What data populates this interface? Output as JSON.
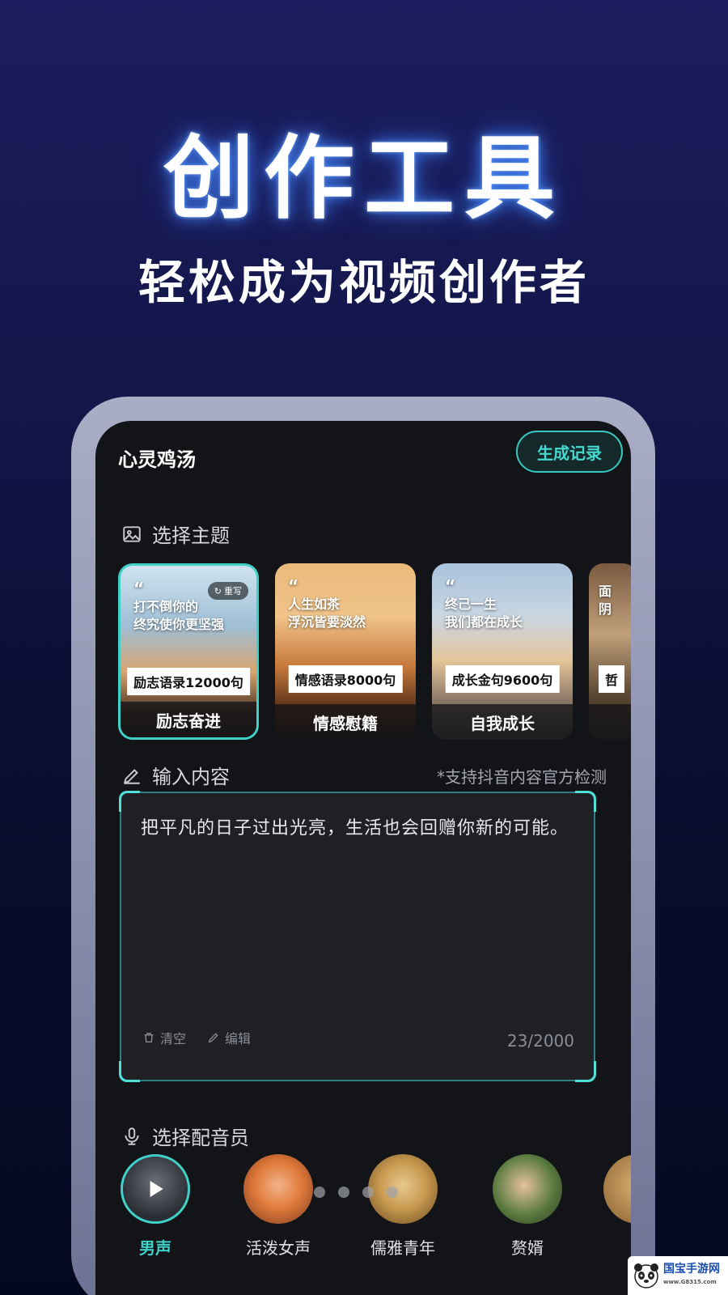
{
  "hero": {
    "title": "创作工具",
    "subtitle": "轻松成为视频创作者"
  },
  "app": {
    "title": "心灵鸡汤",
    "history_button": "生成记录"
  },
  "theme_section": {
    "label": "选择主题"
  },
  "themes": [
    {
      "quote_line1": "打不倒你的",
      "quote_line2": "终究使你更坚强",
      "count": "励志语录12000句",
      "caption": "励志奋进",
      "badge": "重写",
      "selected": true
    },
    {
      "quote_line1": "人生如茶",
      "quote_line2": "浮沉皆要淡然",
      "count": "情感语录8000句",
      "caption": "情感慰籍",
      "selected": false
    },
    {
      "quote_line1": "终己一生",
      "quote_line2": "我们都在成长",
      "count": "成长金句9600句",
      "caption": "自我成长",
      "selected": false
    },
    {
      "quote_line1": "面",
      "quote_line2": "阴",
      "count": "哲",
      "caption": "",
      "selected": false
    }
  ],
  "input_section": {
    "label": "输入内容",
    "note": "*支持抖音内容官方检测"
  },
  "input": {
    "text": "把平凡的日子过出光亮，生活也会回赠你新的可能。",
    "clear_label": "清空",
    "edit_label": "编辑",
    "char_count": "23/2000"
  },
  "voice_section": {
    "label": "选择配音员"
  },
  "voices": [
    {
      "name": "男声",
      "selected": true
    },
    {
      "name": "活泼女声",
      "selected": false
    },
    {
      "name": "儒雅青年",
      "selected": false
    },
    {
      "name": "赘婿",
      "selected": false
    }
  ],
  "watermark": {
    "text": "国宝手游网",
    "url": "www.G8315.com"
  },
  "colors": {
    "accent": "#3fd0c8",
    "background_top": "#1c1d5e",
    "background_bottom": "#04081f",
    "screen": "#131417"
  }
}
